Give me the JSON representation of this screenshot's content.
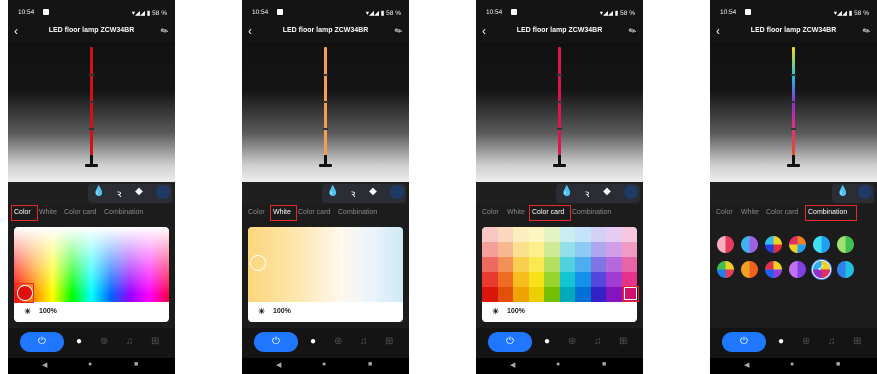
{
  "status": {
    "time": "10:54",
    "battery": "58 %"
  },
  "header": {
    "back": "‹",
    "title": "LED floor lamp ZCW34BR",
    "edit": "✎"
  },
  "tabs": [
    "Color",
    "White",
    "Color card",
    "Combination"
  ],
  "brightness": "100%",
  "icons": {
    "paint": "💧",
    "pen": "ꝛ",
    "eraser": "◆",
    "power": "⏻",
    "bulb": "●",
    "palette": "⊛",
    "music": "♫",
    "grid": "⊞",
    "nav_back": "◀",
    "nav_home": "●",
    "nav_recent": "■",
    "sun": "☀"
  },
  "colors": {
    "accent": "#1f76ff",
    "highlight": "#e5282a"
  },
  "screens": [
    {
      "active_tab": "Color",
      "lamp": [
        "#d0101a",
        "#d0101a",
        "#d0101a"
      ]
    },
    {
      "active_tab": "White",
      "lamp": [
        "#f2a050",
        "#f2a050",
        "#f2a050"
      ]
    },
    {
      "active_tab": "Color card",
      "lamp": [
        "#d8184a",
        "#d8184a",
        "#d8184a"
      ]
    },
    {
      "active_tab": "Combination",
      "lamp": [
        "#f0e020",
        "#20b8e8",
        "#9030d0",
        "#e03080",
        "#e05020"
      ]
    }
  ]
}
